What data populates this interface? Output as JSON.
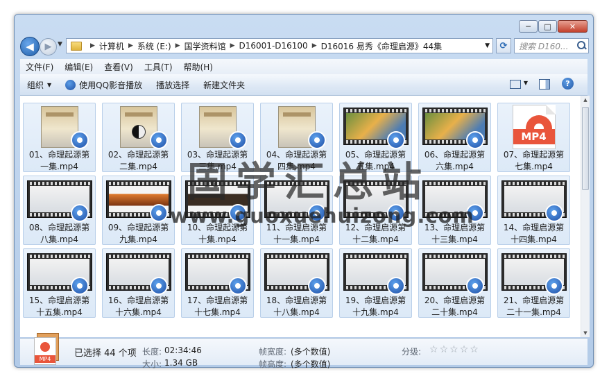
{
  "window": {
    "minimize": "─",
    "maximize": "□",
    "close": "✕"
  },
  "address": {
    "crumbs": [
      "计算机",
      "系统 (E:)",
      "国学资料馆",
      "D16001-D16100",
      "D16016 易秀《命理启源》44集"
    ],
    "search_placeholder": "搜索 D160..."
  },
  "menu": [
    "文件(F)",
    "编辑(E)",
    "查看(V)",
    "工具(T)",
    "帮助(H)"
  ],
  "commands": {
    "organize": "组织",
    "qq_play": "使用QQ影音播放",
    "play_selection": "播放选择",
    "new_folder": "新建文件夹"
  },
  "files": [
    {
      "name": "01、命理起源第一集.mp4",
      "thumb": "doc"
    },
    {
      "name": "02、命理起源第二集.mp4",
      "thumb": "doc-yy"
    },
    {
      "name": "03、命理起源第三集.mp4",
      "thumb": "doc"
    },
    {
      "name": "04、命理起源第四集.mp4",
      "thumb": "doc"
    },
    {
      "name": "05、命理起源第五集.mp4",
      "thumb": "film-color"
    },
    {
      "name": "06、命理起源第六集.mp4",
      "thumb": "film-color"
    },
    {
      "name": "07、命理起源第七集.mp4",
      "thumb": "mp4"
    },
    {
      "name": "08、命理起源第八集.mp4",
      "thumb": "film"
    },
    {
      "name": "09、命理起源第九集.mp4",
      "thumb": "film-sunset"
    },
    {
      "name": "10、命理起源第十集.mp4",
      "thumb": "film-dark"
    },
    {
      "name": "11、命理启源第十一集.mp4",
      "thumb": "film"
    },
    {
      "name": "12、命理启源第十二集.mp4",
      "thumb": "film"
    },
    {
      "name": "13、命理启源第十三集.mp4",
      "thumb": "film"
    },
    {
      "name": "14、命理启源第十四集.mp4",
      "thumb": "film"
    },
    {
      "name": "15、命理启源第十五集.mp4",
      "thumb": "film"
    },
    {
      "name": "16、命理启源第十六集.mp4",
      "thumb": "film"
    },
    {
      "name": "17、命理启源第十七集.mp4",
      "thumb": "film"
    },
    {
      "name": "18、命理启源第十八集.mp4",
      "thumb": "film"
    },
    {
      "name": "19、命理启源第十九集.mp4",
      "thumb": "film"
    },
    {
      "name": "20、命理启源第二十集.mp4",
      "thumb": "film"
    },
    {
      "name": "21、命理启源第二十一集.mp4",
      "thumb": "film"
    }
  ],
  "details": {
    "selected": "已选择 44 个项",
    "length_label": "长度:",
    "length_value": "02:34:46",
    "size_label": "大小:",
    "size_value": "1.34 GB",
    "framewidth_label": "帧宽度:",
    "framewidth_value": "(多个数值)",
    "frameheight_label": "帧高度:",
    "frameheight_value": "(多个数值)",
    "rating_label": "分级:",
    "rating_stars": 0,
    "icon_text": "MP4"
  },
  "watermark": {
    "line1": "国学汇总站",
    "line2": "www.guoxuehuizong.com"
  }
}
